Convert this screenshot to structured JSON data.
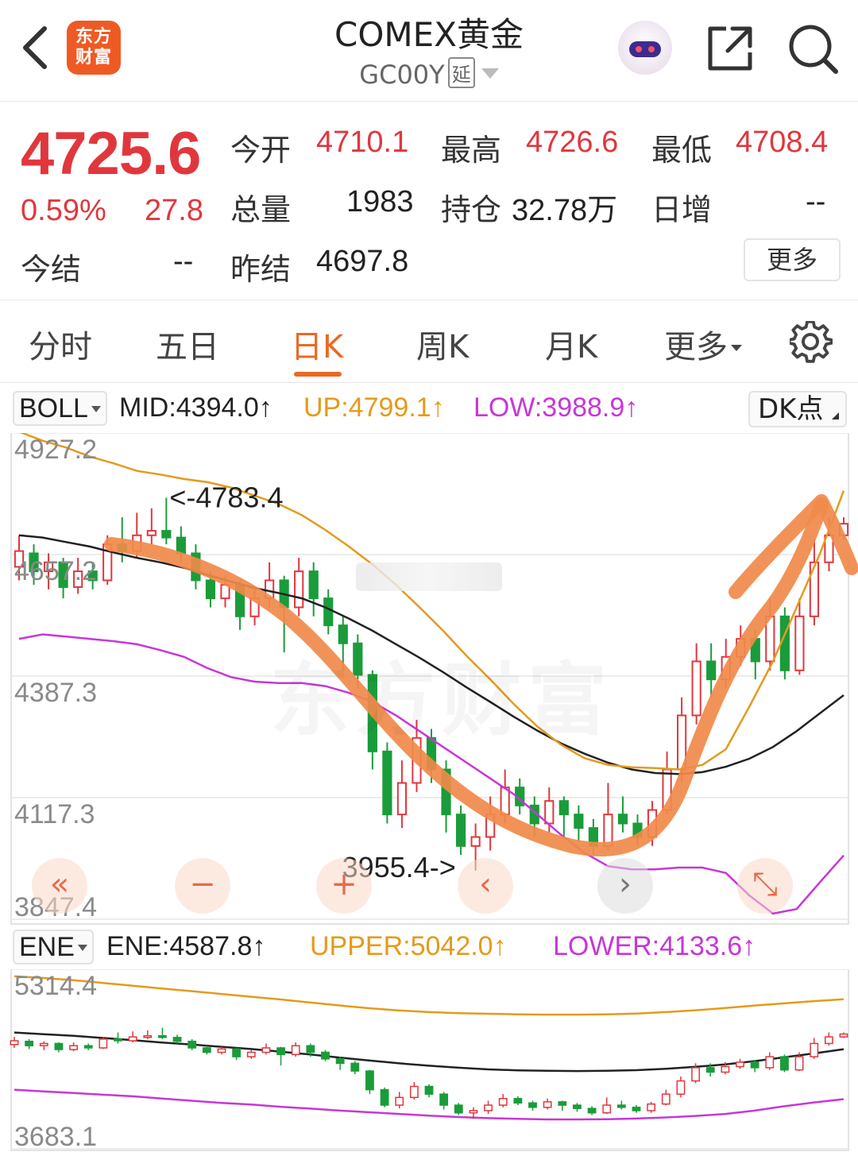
{
  "header": {
    "logo_text_1": "东方",
    "logo_text_2": "财富",
    "title": "COMEX黄金",
    "code": "GC00Y",
    "delay_tag": "延"
  },
  "quote": {
    "price": "4725.6",
    "change_pct": "0.59%",
    "change": "27.8",
    "settle_label": "今结",
    "settle_value": "--",
    "open_label": "今开",
    "open_value": "4710.1",
    "high_label": "最高",
    "high_value": "4726.6",
    "low_label": "最低",
    "low_value": "4708.4",
    "volume_label": "总量",
    "volume_value": "1983",
    "position_label": "持仓",
    "position_value": "32.78万",
    "daily_inc_label": "日增",
    "daily_inc_value": "--",
    "prev_settle_label": "昨结",
    "prev_settle_value": "4697.8",
    "more_label": "更多"
  },
  "tabs": [
    {
      "label": "分时",
      "active": false
    },
    {
      "label": "五日",
      "active": false
    },
    {
      "label": "日K",
      "active": true
    },
    {
      "label": "周K",
      "active": false
    },
    {
      "label": "月K",
      "active": false
    },
    {
      "label": "更多",
      "active": false
    }
  ],
  "boll": {
    "selector": "BOLL",
    "mid": "MID:4394.0↑",
    "up": "UP:4799.1↑",
    "low": "LOW:3988.9↑",
    "dk_label": "DK点"
  },
  "ene": {
    "selector": "ENE",
    "ene": "ENE:4587.8↑",
    "upper": "UPPER:5042.0↑",
    "lower": "LOWER:4133.6↑"
  },
  "watermark": "东方财富",
  "colors": {
    "up": "#e0373d",
    "down": "#1a9c3a",
    "mid_line": "#222222",
    "upper_line": "#e59a1c",
    "lower_line": "#c737d6",
    "accent": "#e86a24",
    "annotation": "#f08a4a"
  },
  "chart_data": [
    {
      "type": "candlestick",
      "name": "BOLL",
      "y_ticks": [
        "4927.2",
        "4657.2",
        "4387.3",
        "4117.3",
        "3847.4"
      ],
      "y_tick_values": [
        4927.2,
        4657.2,
        4387.3,
        4117.3,
        3847.4
      ],
      "ylim": [
        3847.4,
        4927.2
      ],
      "annotations": [
        {
          "text": "<-4783.4",
          "value": 4783.4
        },
        {
          "text": "3955.4->",
          "value": 3955.4
        }
      ],
      "grid": true,
      "series": [
        {
          "name": "MID",
          "values": [
            4700,
            4695,
            4685,
            4675,
            4662,
            4650,
            4640,
            4628,
            4612,
            4597,
            4583,
            4572,
            4560,
            4540,
            4515,
            4488,
            4458,
            4428,
            4396,
            4362,
            4330,
            4297,
            4266,
            4238,
            4215,
            4195,
            4180,
            4172,
            4170,
            4174,
            4186,
            4204,
            4230,
            4265,
            4305,
            4345
          ]
        },
        {
          "name": "UP",
          "values": [
            4930,
            4910,
            4895,
            4875,
            4860,
            4843,
            4835,
            4825,
            4818,
            4806,
            4788,
            4770,
            4745,
            4712,
            4675,
            4635,
            4590,
            4540,
            4488,
            4432,
            4380,
            4325,
            4275,
            4235,
            4205,
            4190,
            4185,
            4183,
            4180,
            4190,
            4225,
            4320,
            4420,
            4540,
            4660,
            4799
          ]
        },
        {
          "name": "LOW",
          "values": [
            4470,
            4480,
            4475,
            4470,
            4465,
            4458,
            4445,
            4430,
            4405,
            4385,
            4375,
            4372,
            4372,
            4365,
            4350,
            4330,
            4300,
            4265,
            4230,
            4195,
            4160,
            4125,
            4080,
            4035,
            3995,
            3965,
            3958,
            3958,
            3962,
            3962,
            3950,
            3900,
            3860,
            3870,
            3930,
            3989
          ]
        }
      ],
      "candles": [
        {
          "o": 4630,
          "c": 4665,
          "h": 4700,
          "l": 4600
        },
        {
          "o": 4660,
          "c": 4620,
          "h": 4680,
          "l": 4590
        },
        {
          "o": 4620,
          "c": 4640,
          "h": 4660,
          "l": 4580
        },
        {
          "o": 4640,
          "c": 4585,
          "h": 4650,
          "l": 4560
        },
        {
          "o": 4585,
          "c": 4620,
          "h": 4650,
          "l": 4570
        },
        {
          "o": 4620,
          "c": 4600,
          "h": 4640,
          "l": 4580
        },
        {
          "o": 4600,
          "c": 4680,
          "h": 4700,
          "l": 4590
        },
        {
          "o": 4680,
          "c": 4665,
          "h": 4740,
          "l": 4640
        },
        {
          "o": 4665,
          "c": 4700,
          "h": 4750,
          "l": 4650
        },
        {
          "o": 4700,
          "c": 4710,
          "h": 4760,
          "l": 4680
        },
        {
          "o": 4710,
          "c": 4695,
          "h": 4783.4,
          "l": 4680
        },
        {
          "o": 4695,
          "c": 4660,
          "h": 4720,
          "l": 4640
        },
        {
          "o": 4660,
          "c": 4600,
          "h": 4680,
          "l": 4580
        },
        {
          "o": 4600,
          "c": 4560,
          "h": 4620,
          "l": 4540
        },
        {
          "o": 4560,
          "c": 4590,
          "h": 4610,
          "l": 4540
        },
        {
          "o": 4590,
          "c": 4520,
          "h": 4600,
          "l": 4490
        },
        {
          "o": 4520,
          "c": 4560,
          "h": 4580,
          "l": 4500
        },
        {
          "o": 4560,
          "c": 4600,
          "h": 4640,
          "l": 4540
        },
        {
          "o": 4600,
          "c": 4540,
          "h": 4610,
          "l": 4440
        },
        {
          "o": 4540,
          "c": 4620,
          "h": 4650,
          "l": 4520
        },
        {
          "o": 4620,
          "c": 4560,
          "h": 4640,
          "l": 4520
        },
        {
          "o": 4560,
          "c": 4500,
          "h": 4580,
          "l": 4480
        },
        {
          "o": 4500,
          "c": 4460,
          "h": 4520,
          "l": 4400
        },
        {
          "o": 4460,
          "c": 4390,
          "h": 4480,
          "l": 4360
        },
        {
          "o": 4390,
          "c": 4220,
          "h": 4400,
          "l": 4180
        },
        {
          "o": 4220,
          "c": 4080,
          "h": 4240,
          "l": 4060
        },
        {
          "o": 4080,
          "c": 4150,
          "h": 4200,
          "l": 4050
        },
        {
          "o": 4150,
          "c": 4250,
          "h": 4290,
          "l": 4130
        },
        {
          "o": 4250,
          "c": 4180,
          "h": 4270,
          "l": 4150
        },
        {
          "o": 4180,
          "c": 4080,
          "h": 4200,
          "l": 4040
        },
        {
          "o": 4080,
          "c": 4010,
          "h": 4100,
          "l": 3990
        },
        {
          "o": 4010,
          "c": 4030,
          "h": 4060,
          "l": 3955.4
        },
        {
          "o": 4030,
          "c": 4080,
          "h": 4120,
          "l": 4000
        },
        {
          "o": 4080,
          "c": 4140,
          "h": 4180,
          "l": 4060
        },
        {
          "o": 4140,
          "c": 4100,
          "h": 4160,
          "l": 4080
        },
        {
          "o": 4100,
          "c": 4060,
          "h": 4120,
          "l": 4030
        },
        {
          "o": 4060,
          "c": 4110,
          "h": 4140,
          "l": 4040
        },
        {
          "o": 4110,
          "c": 4080,
          "h": 4120,
          "l": 4030
        },
        {
          "o": 4080,
          "c": 4050,
          "h": 4100,
          "l": 4020
        },
        {
          "o": 4050,
          "c": 4010,
          "h": 4070,
          "l": 3990
        },
        {
          "o": 4010,
          "c": 4080,
          "h": 4150,
          "l": 4000
        },
        {
          "o": 4080,
          "c": 4060,
          "h": 4120,
          "l": 4040
        },
        {
          "o": 4060,
          "c": 4030,
          "h": 4080,
          "l": 4010
        },
        {
          "o": 4030,
          "c": 4090,
          "h": 4110,
          "l": 4010
        },
        {
          "o": 4090,
          "c": 4180,
          "h": 4220,
          "l": 4080
        },
        {
          "o": 4180,
          "c": 4300,
          "h": 4340,
          "l": 4150
        },
        {
          "o": 4300,
          "c": 4420,
          "h": 4460,
          "l": 4280
        },
        {
          "o": 4420,
          "c": 4380,
          "h": 4460,
          "l": 4340
        },
        {
          "o": 4380,
          "c": 4430,
          "h": 4470,
          "l": 4360
        },
        {
          "o": 4430,
          "c": 4470,
          "h": 4500,
          "l": 4410
        },
        {
          "o": 4470,
          "c": 4420,
          "h": 4490,
          "l": 4380
        },
        {
          "o": 4420,
          "c": 4520,
          "h": 4560,
          "l": 4400
        },
        {
          "o": 4520,
          "c": 4400,
          "h": 4540,
          "l": 4380
        },
        {
          "o": 4400,
          "c": 4520,
          "h": 4560,
          "l": 4390
        },
        {
          "o": 4520,
          "c": 4640,
          "h": 4690,
          "l": 4500
        },
        {
          "o": 4640,
          "c": 4700,
          "h": 4740,
          "l": 4620
        },
        {
          "o": 4700,
          "c": 4725.6,
          "h": 4740,
          "l": 4690
        }
      ]
    },
    {
      "type": "candlestick",
      "name": "ENE",
      "y_ticks": [
        "5314.4",
        "3683.1"
      ],
      "y_tick_values": [
        5314.4,
        3683.1
      ],
      "ylim": [
        3683.1,
        5314.4
      ],
      "series": [
        {
          "name": "ENE",
          "values": [
            4740,
            4725,
            4710,
            4690,
            4670,
            4648,
            4630,
            4610,
            4590,
            4565,
            4540,
            4512,
            4485,
            4460,
            4438,
            4420,
            4405,
            4396,
            4392,
            4390,
            4392,
            4398,
            4410,
            4428,
            4450,
            4480,
            4515,
            4550,
            4588
          ]
        },
        {
          "name": "UPPER",
          "values": [
            5250,
            5235,
            5215,
            5190,
            5165,
            5140,
            5115,
            5090,
            5065,
            5040,
            5012,
            4985,
            4960,
            4940,
            4925,
            4915,
            4910,
            4905,
            4902,
            4902,
            4905,
            4912,
            4925,
            4942,
            4962,
            4985,
            5005,
            5025,
            5042
          ]
        },
        {
          "name": "LOWER",
          "values": [
            4220,
            4205,
            4190,
            4175,
            4160,
            4140,
            4120,
            4100,
            4085,
            4065,
            4048,
            4030,
            4015,
            4000,
            3985,
            3972,
            3962,
            3955,
            3950,
            3950,
            3952,
            3958,
            3968,
            3982,
            4000,
            4030,
            4070,
            4105,
            4134
          ]
        }
      ]
    }
  ]
}
